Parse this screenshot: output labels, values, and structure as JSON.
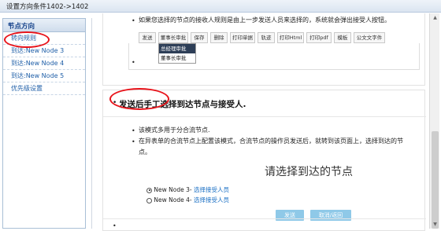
{
  "window": {
    "title": "设置方向条件1402->1402"
  },
  "sidebar": {
    "header": "节点方向",
    "collapse_icon": "«",
    "items": [
      {
        "label": "转向规则"
      },
      {
        "label": "到达:New Node 3"
      },
      {
        "label": "到达:New Node 4"
      },
      {
        "label": "到达:New Node 5"
      },
      {
        "label": "优先级设置"
      }
    ]
  },
  "section1": {
    "text": "如果您选择的节点的接收人规则是由上一步发送人员来选择的，系统就会弹出接受人按钮。",
    "toolbar": [
      "发送",
      "董事长审批",
      "保存",
      "删除",
      "打印单据",
      "轨迹",
      "打印Html",
      "打印pdf",
      "模板",
      "公文文字件"
    ],
    "dropdown": [
      "总经理审批",
      "董事长审批"
    ]
  },
  "section2": {
    "title": "发送后手工选择到达节点与接受人.",
    "bullets": [
      "该模式多用于分合流节点.",
      "在异表单的合流节点上配置该模式，合流节点的操作员发送后，就转到该页面上，选择到达的节点。"
    ],
    "dialog_title": "请选择到达的节点",
    "options": [
      {
        "node": "New Node 3-",
        "link": "选择接受人员",
        "selected": true
      },
      {
        "node": "New Node 4-",
        "link": "选择接受人员",
        "selected": false
      }
    ],
    "buttons": {
      "send": "发送",
      "cancel": "取消/返回"
    }
  },
  "colors": {
    "accent": "#1f5fa8",
    "highlight": "#e8131a",
    "button": "#8fc9e8"
  }
}
